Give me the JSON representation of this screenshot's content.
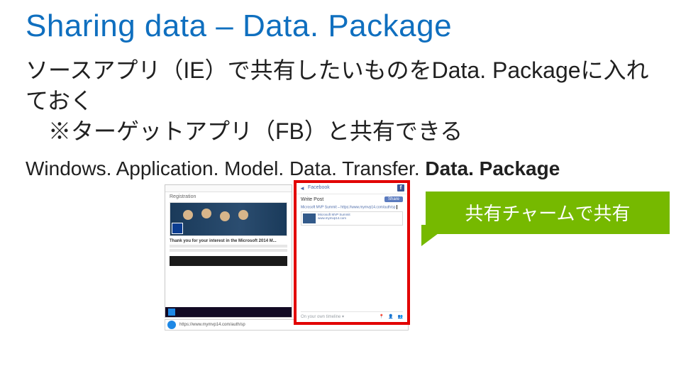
{
  "title": "Sharing data – Data. Package",
  "subtitle_line1": "ソースアプリ（IE）で共有したいものをData. Packageに入れておく",
  "subtitle_line2": "※ターゲットアプリ（FB）と共有できる",
  "api_prefix": "Windows. Application. Model. Data. Transfer. ",
  "api_bold": "Data. Package",
  "callout": "共有チャームで共有",
  "reg_word": "Registration",
  "thanks_text": "Thank you for your interest in the Microsoft 2014 M...",
  "fb_name": "Facebook",
  "fb_logo": "f",
  "write_post": "Write Post",
  "share_btn": "Share",
  "share_blurb": "Microsoft MVP Summit – https://www.mymvp14.com/auth/sp",
  "card_title": "Microsoft MVP Summit",
  "card_sub": "www.mymvp14.com",
  "footer_left": "On your own timeline ▾",
  "url": "https://www.mymvp14.com/auth/sp",
  "icon_pin": "📍",
  "icon_person": "👤",
  "icon_people": "👥",
  "back_arrow": "◄"
}
